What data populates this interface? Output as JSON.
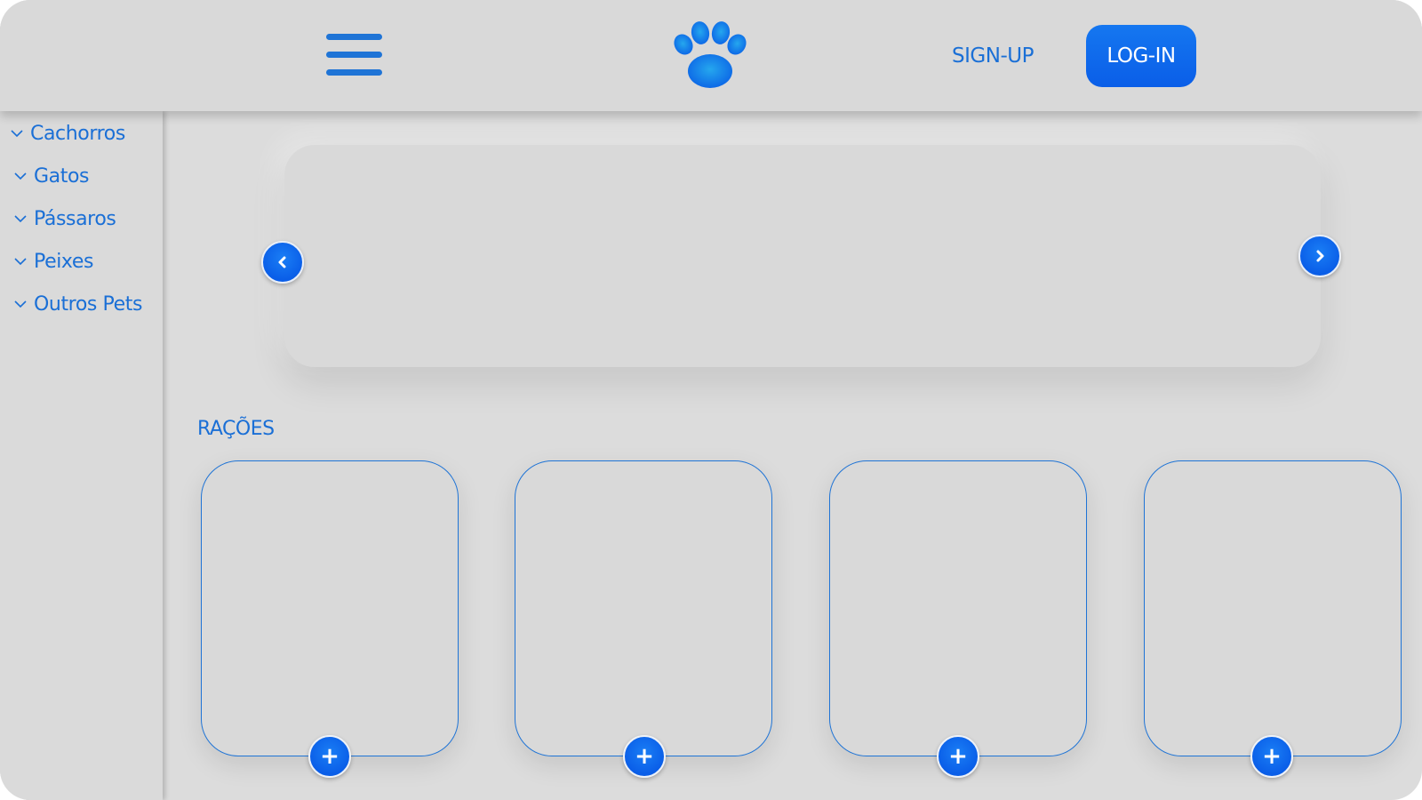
{
  "header": {
    "menu_icon": "hamburger-menu-icon",
    "logo_icon": "paw-print-icon",
    "signup_label": "SIGN-UP",
    "login_label": "LOG-IN"
  },
  "sidebar": {
    "items": [
      {
        "label": "Cachorros",
        "icon": "chevron-down-icon"
      },
      {
        "label": "Gatos",
        "icon": "chevron-down-icon"
      },
      {
        "label": "Pássaros",
        "icon": "chevron-down-icon"
      },
      {
        "label": "Peixes",
        "icon": "chevron-down-icon"
      },
      {
        "label": "Outros Pets",
        "icon": "chevron-down-icon"
      }
    ]
  },
  "carousel": {
    "prev_icon": "chevron-left-icon",
    "next_icon": "chevron-right-icon"
  },
  "products": {
    "section_title": "RAÇÕES",
    "cards": [
      {
        "add_label": "+"
      },
      {
        "add_label": "+"
      },
      {
        "add_label": "+"
      },
      {
        "add_label": "+"
      }
    ]
  },
  "colors": {
    "accent": "#1f74d6",
    "button": "#0a5ee8",
    "background": "#dcdcdc"
  }
}
